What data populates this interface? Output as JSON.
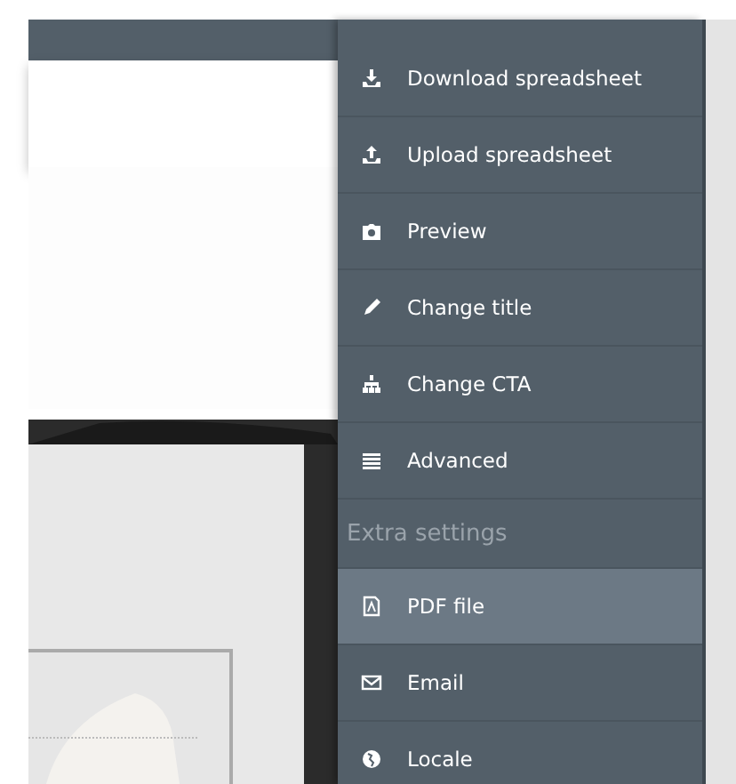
{
  "menu": {
    "items": [
      {
        "kind": "item",
        "label": "Download spreadsheet",
        "selected": false
      },
      {
        "kind": "item",
        "label": "Upload spreadsheet",
        "selected": false
      },
      {
        "kind": "item",
        "label": "Preview",
        "selected": false
      },
      {
        "kind": "item",
        "label": "Change title",
        "selected": false
      },
      {
        "kind": "item",
        "label": "Change CTA",
        "selected": false
      },
      {
        "kind": "item",
        "label": "Advanced",
        "selected": false
      },
      {
        "kind": "header",
        "label": "Extra settings"
      },
      {
        "kind": "item",
        "label": "PDF file",
        "selected": true
      },
      {
        "kind": "item",
        "label": "Email",
        "selected": false
      },
      {
        "kind": "item",
        "label": "Locale",
        "selected": false
      }
    ]
  }
}
